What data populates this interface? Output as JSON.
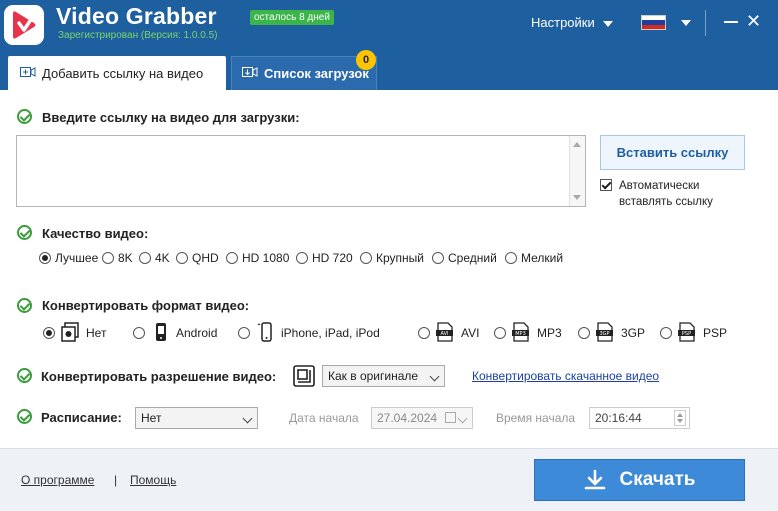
{
  "header": {
    "app_title": "Video Grabber",
    "trial_badge": "осталось 8 дней",
    "version": "Зарегистрирован (Версия: 1.0.0.5)",
    "settings_label": "Настройки",
    "accent_color": "#1e5fa0"
  },
  "tabs": [
    {
      "label": "Добавить ссылку на видео",
      "active": true,
      "icon": "add-video-icon"
    },
    {
      "label": "Список загрузок",
      "active": false,
      "icon": "download-list-icon",
      "badge": "0"
    }
  ],
  "url_section": {
    "label": "Введите ссылку на видео для загрузки:",
    "value": "",
    "paste_button": "Вставить ссылку",
    "auto_paste_label": "Автоматически вставлять ссылку",
    "auto_paste_checked": true
  },
  "quality": {
    "label": "Качество видео:",
    "options": [
      "Лучшее",
      "8K",
      "4K",
      "QHD",
      "HD 1080",
      "HD 720",
      "Крупный",
      "Средний",
      "Мелкий"
    ],
    "selected": "Лучшее"
  },
  "format": {
    "label": "Конвертировать формат видео:",
    "options": [
      {
        "label": "Нет",
        "icon": "no-convert-icon"
      },
      {
        "label": "Android",
        "icon": "android-icon"
      },
      {
        "label": "iPhone, iPad, iPod",
        "icon": "iphone-icon"
      },
      {
        "label": "AVI",
        "icon": "avi-file-icon"
      },
      {
        "label": "MP3",
        "icon": "mp3-file-icon"
      },
      {
        "label": "3GP",
        "icon": "3gp-file-icon"
      },
      {
        "label": "PSP",
        "icon": "psp-file-icon"
      }
    ],
    "selected": "Нет"
  },
  "resolution": {
    "label": "Конвертировать разрешение видео:",
    "select_value": "Как в оригинале",
    "convert_link": "Конвертировать скачанное видео"
  },
  "schedule": {
    "label": "Расписание:",
    "select_value": "Нет",
    "start_date_label": "Дата начала",
    "start_date": "27.04.2024",
    "start_time_label": "Время начала",
    "start_time": "20:16:44"
  },
  "footer": {
    "about": "О программе",
    "separator": "|",
    "help": "Помощь",
    "download_button": "Скачать"
  }
}
